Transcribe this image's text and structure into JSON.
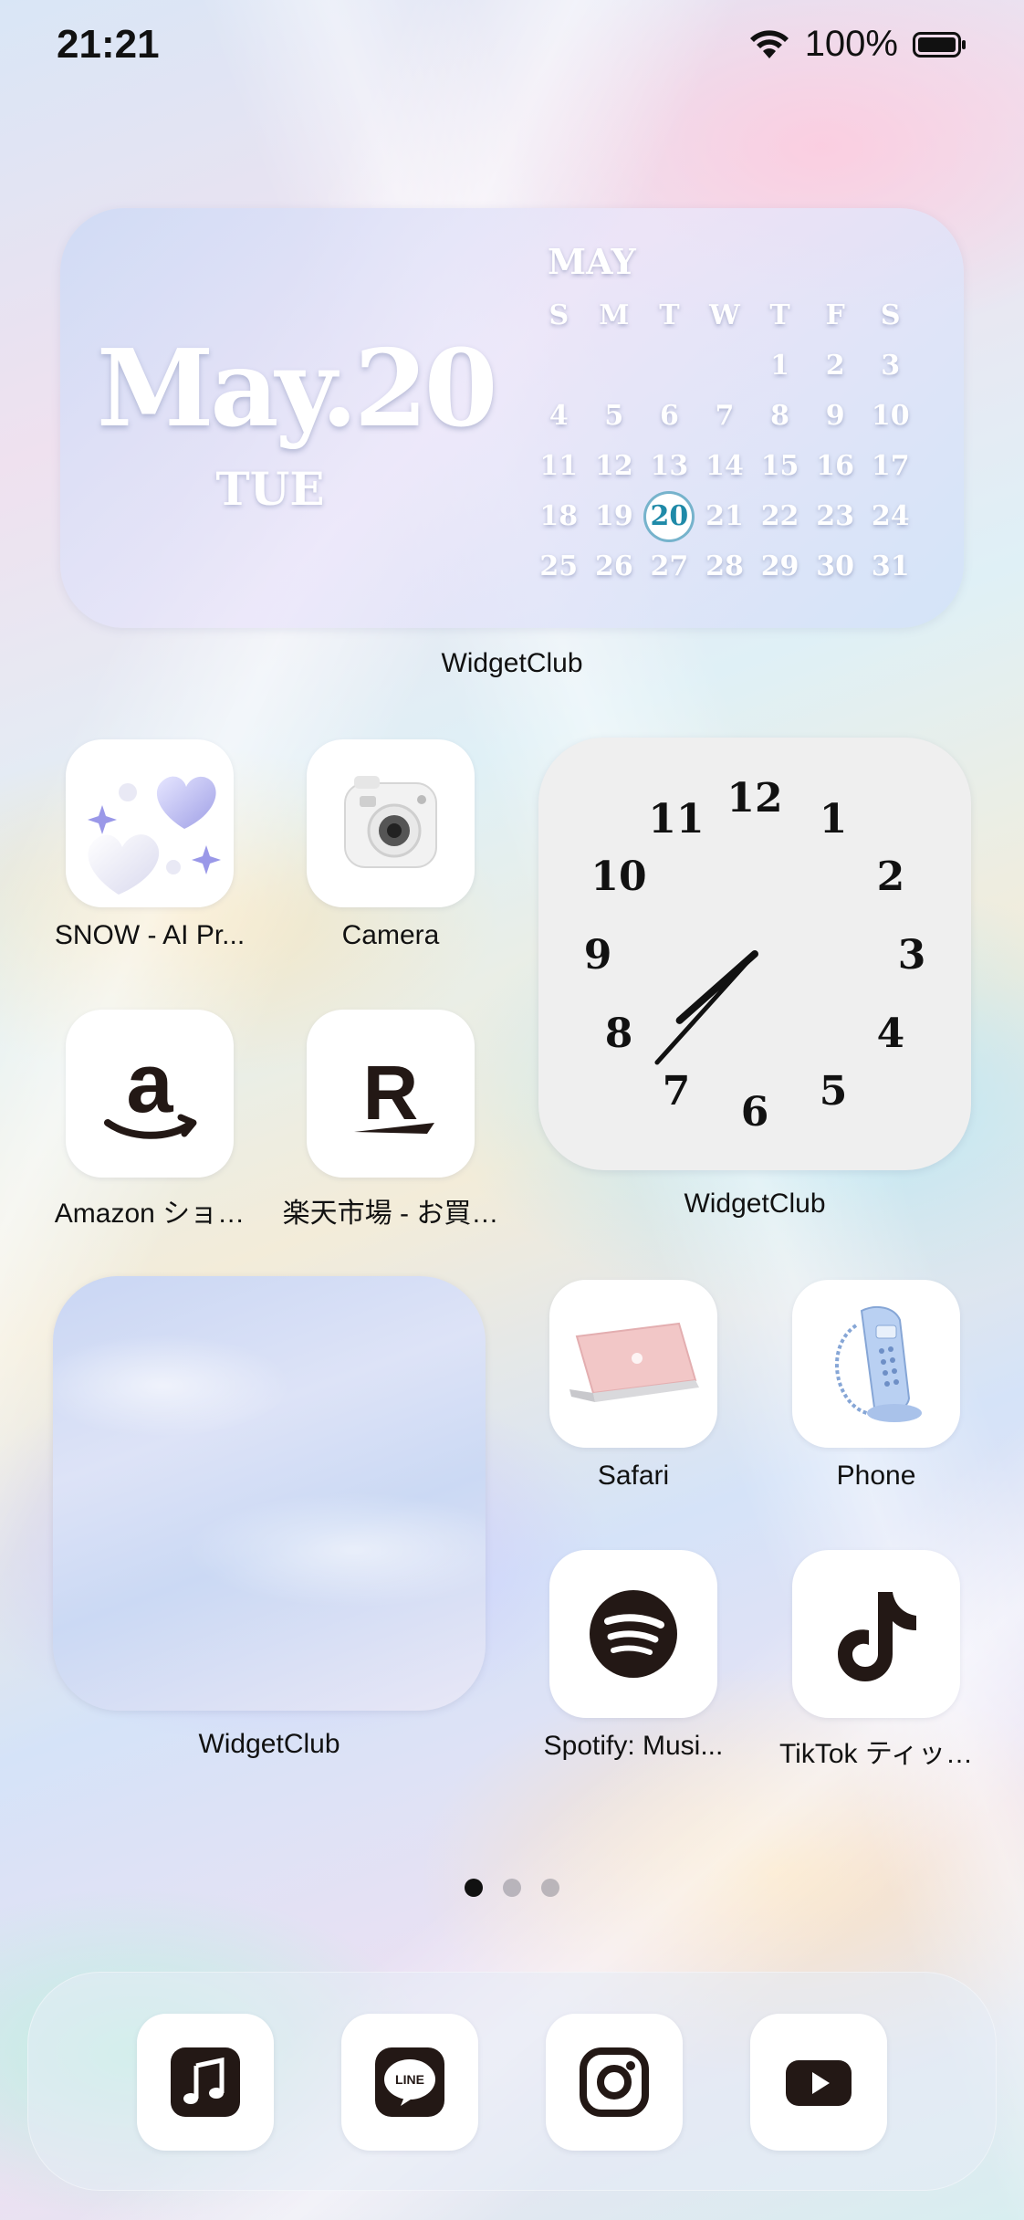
{
  "status_bar": {
    "time": "21:21",
    "battery": "100%"
  },
  "calendar_widget": {
    "date": "May.20",
    "weekday": "TUE",
    "month": "MAY",
    "weekday_headers": [
      "S",
      "M",
      "T",
      "W",
      "T",
      "F",
      "S"
    ],
    "days": [
      "",
      "",
      "",
      "",
      "1",
      "2",
      "3",
      "4",
      "5",
      "6",
      "7",
      "8",
      "9",
      "10",
      "11",
      "12",
      "13",
      "14",
      "15",
      "16",
      "17",
      "18",
      "19",
      "20",
      "21",
      "22",
      "23",
      "24",
      "25",
      "26",
      "27",
      "28",
      "29",
      "30",
      "31"
    ],
    "today": "20",
    "label": "WidgetClub"
  },
  "apps": {
    "snow": "SNOW - AI Pr...",
    "camera": "Camera",
    "amazon": "Amazon ショ…",
    "rakuten": "楽天市場 - お買…",
    "safari": "Safari",
    "phone": "Phone",
    "spotify": "Spotify: Musi...",
    "tiktok": "TikTok ティッ…"
  },
  "clock_widget": {
    "label": "WidgetClub",
    "numerals": [
      "12",
      "1",
      "2",
      "3",
      "4",
      "5",
      "6",
      "7",
      "8",
      "9",
      "10",
      "11"
    ],
    "time_shown": "7:37"
  },
  "photo_widget": {
    "label": "WidgetClub"
  },
  "page_indicator": {
    "pages": 3,
    "current": 1
  },
  "dock": [
    "music-icon",
    "line-icon",
    "instagram-icon",
    "youtube-icon"
  ],
  "colors": {
    "today_accent": "#1f8aa8",
    "icon_dark": "#231815"
  }
}
